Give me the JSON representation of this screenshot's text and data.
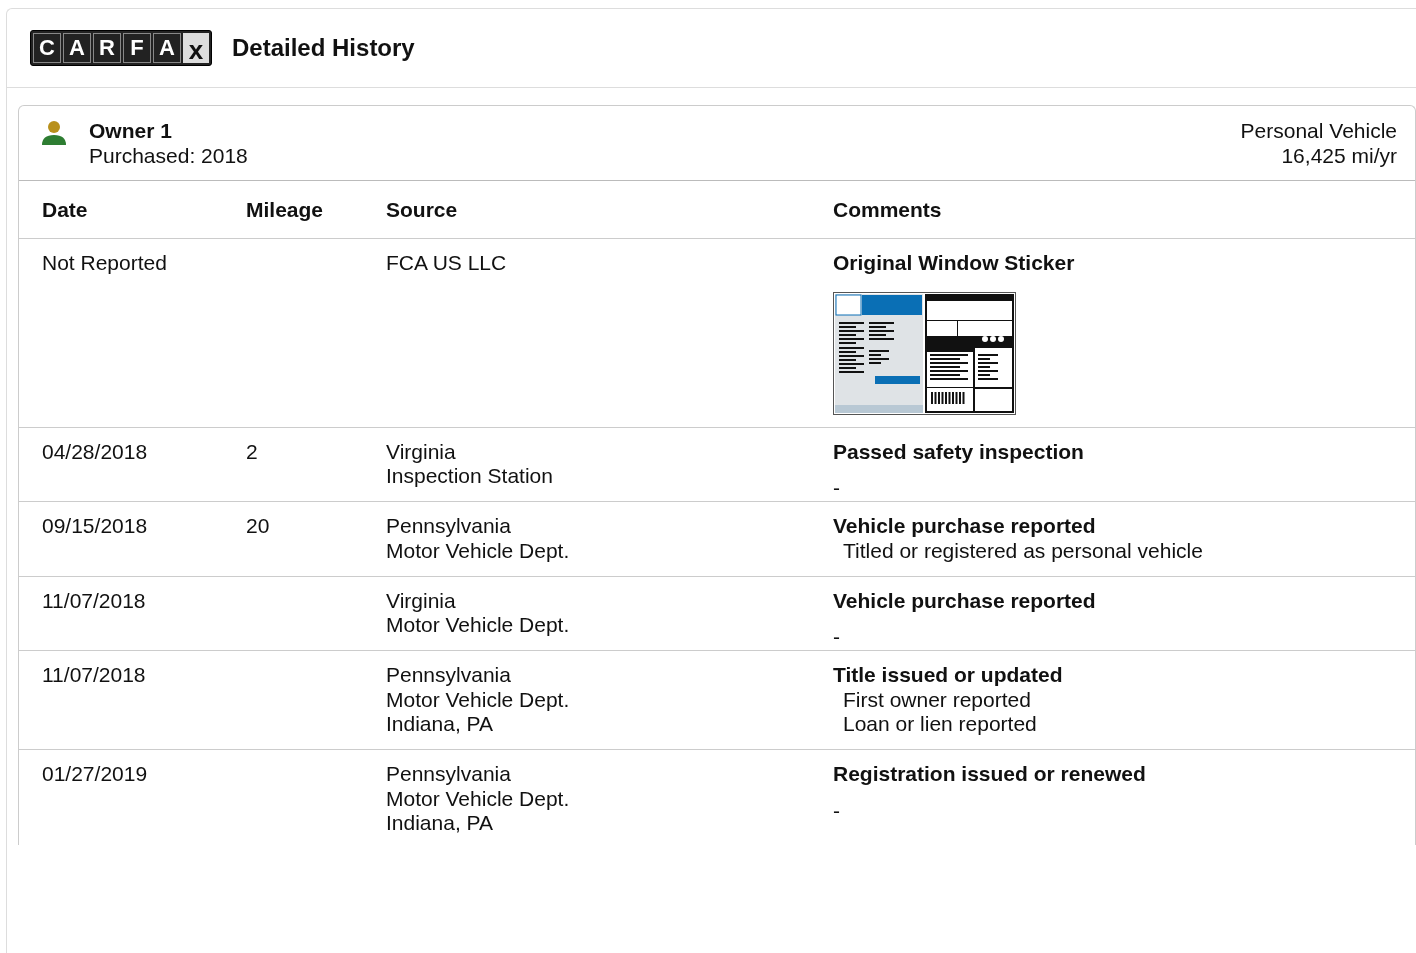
{
  "header": {
    "logo_letters": [
      "C",
      "A",
      "R",
      "F",
      "A",
      "x"
    ],
    "title": "Detailed History"
  },
  "owner": {
    "name": "Owner 1",
    "purchased": "Purchased: 2018",
    "vehicle_type": "Personal Vehicle",
    "mileage_rate": "16,425 mi/yr"
  },
  "table": {
    "columns": [
      "Date",
      "Mileage",
      "Source",
      "Comments"
    ],
    "rows": [
      {
        "date": "Not Reported",
        "source": [
          "FCA US LLC"
        ],
        "comment": {
          "kind": "sticker",
          "title": "Original Window Sticker"
        }
      },
      {
        "date": "04/28/2018",
        "mileage": "2",
        "source": [
          "Virginia",
          "Inspection Station"
        ],
        "comment": {
          "kind": "event",
          "title": "Passed safety inspection",
          "note": "-"
        }
      },
      {
        "date": "09/15/2018",
        "mileage": "20",
        "source": [
          "Pennsylvania",
          "Motor Vehicle Dept."
        ],
        "comment": {
          "kind": "event",
          "title": "Vehicle purchase reported",
          "details": [
            "Titled or registered as personal vehicle"
          ]
        }
      },
      {
        "date": "11/07/2018",
        "source": [
          "Virginia",
          "Motor Vehicle Dept."
        ],
        "comment": {
          "kind": "event",
          "title": "Vehicle purchase reported",
          "note": "-"
        }
      },
      {
        "date": "11/07/2018",
        "source": [
          "Pennsylvania",
          "Motor Vehicle Dept.",
          "Indiana, PA"
        ],
        "comment": {
          "kind": "event",
          "title": "Title issued or updated",
          "details": [
            "First owner reported",
            "Loan or lien reported"
          ]
        }
      },
      {
        "date": "01/27/2019",
        "source": [
          "Pennsylvania",
          "Motor Vehicle Dept.",
          "Indiana, PA"
        ],
        "comment": {
          "kind": "event",
          "title": "Registration issued or renewed",
          "note": "-"
        }
      }
    ]
  }
}
